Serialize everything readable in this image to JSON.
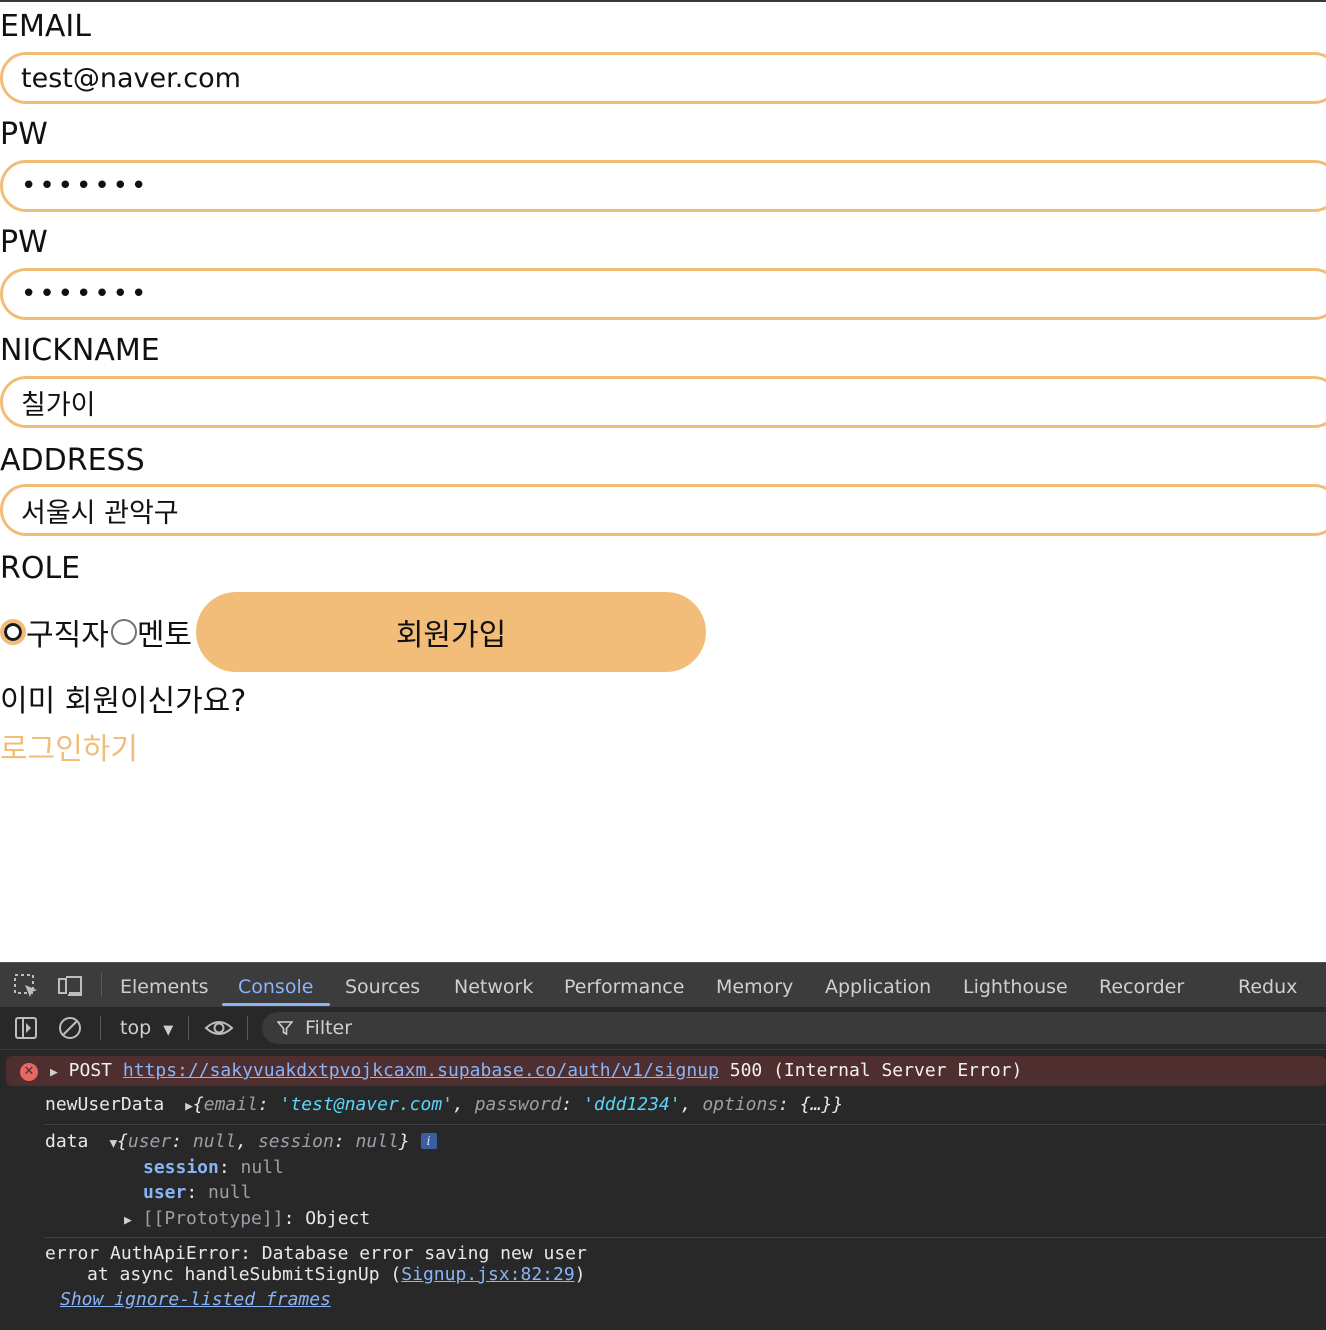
{
  "form": {
    "email_label": "EMAIL",
    "email_value": "test@naver.com",
    "pw_label": "PW",
    "pw_value": "ddd1234",
    "pw_confirm_label": "PW",
    "pw_confirm_value": "ddd1234",
    "nickname_label": "NICKNAME",
    "nickname_value": "칠가이",
    "address_label": "ADDRESS",
    "address_value": "서울시 관악구",
    "role_label": "ROLE",
    "role_options": [
      "구직자",
      "멘토"
    ],
    "role_selected": "구직자",
    "submit_label": "회원가입",
    "already_member_text": "이미 회원이신가요?",
    "login_link": "로그인하기",
    "accent_color": "#f2bd78"
  },
  "devtools": {
    "tabs": [
      "Elements",
      "Console",
      "Sources",
      "Network",
      "Performance",
      "Memory",
      "Application",
      "Lighthouse",
      "Recorder",
      "Redux"
    ],
    "active_tab": "Console",
    "context": "top",
    "filter_placeholder": "Filter",
    "console": {
      "error_method": "POST",
      "error_url": "https://sakyvuakdxtpvojkcaxm.supabase.co/auth/v1/signup",
      "error_status": "500 (Internal Server Error)",
      "log1_label": "newUserData",
      "log1_key_email": "email",
      "log1_val_email": "'test@naver.com'",
      "log1_key_password": "password",
      "log1_val_password": "'ddd1234'",
      "log1_key_options": "options",
      "log1_val_options": "{…}",
      "log2_label": "data",
      "log2_key_user": "user",
      "log2_key_session": "session",
      "null": "null",
      "prop_session": "session",
      "prop_user": "user",
      "prototype_text": "[[Prototype]]",
      "prototype_value": "Object",
      "log3_line1": "error AuthApiError: Database error saving new user",
      "log3_line2_prefix": "at async handleSubmitSignUp (",
      "log3_line2_link": "Signup.jsx:82:29",
      "log3_line2_suffix": ")",
      "ignore_listed_link": "Show ignore-listed frames"
    }
  }
}
